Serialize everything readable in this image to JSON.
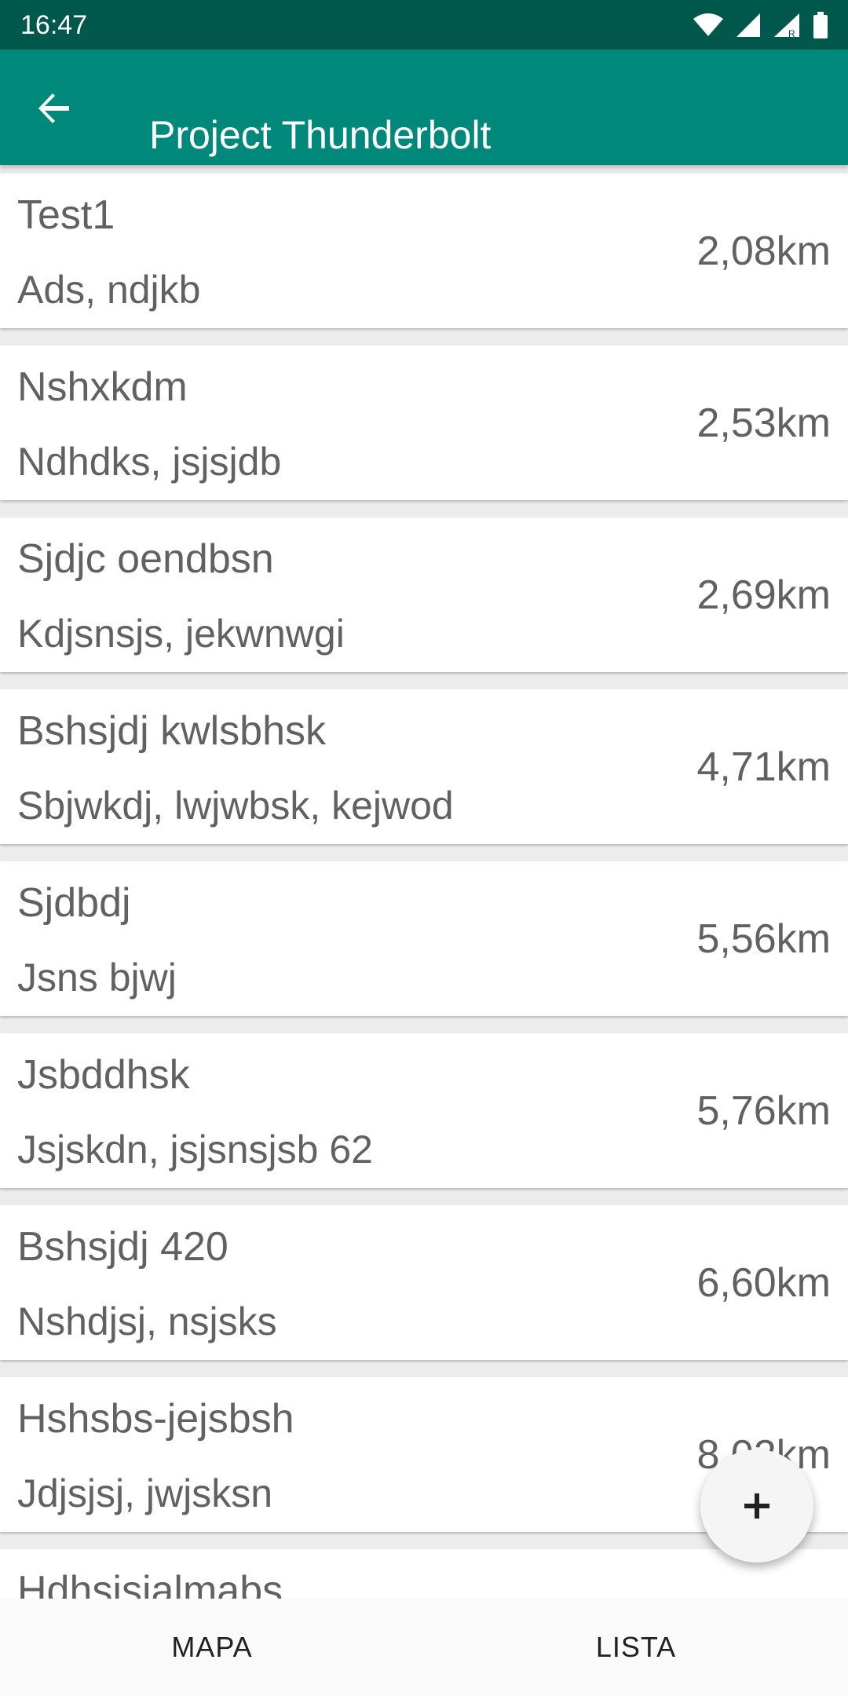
{
  "status_bar": {
    "time": "16:47",
    "icons": [
      "wifi-icon",
      "cellular-signal-icon",
      "cellular-signal-roaming-icon",
      "battery-icon"
    ],
    "background": "#00574b"
  },
  "app_bar": {
    "title": "Project Thunderbolt",
    "back_icon": "arrow-back-icon",
    "background": "#00897b"
  },
  "places": [
    {
      "name": "Test1",
      "address": "Ads, ndjkb",
      "distance": "2,08km"
    },
    {
      "name": "Nshxkdm",
      "address": "Ndhdks, jsjsjdb",
      "distance": "2,53km"
    },
    {
      "name": "Sjdjc oendbsn",
      "address": "Kdjsnsjs, jekwnwgi",
      "distance": "2,69km"
    },
    {
      "name": "Bshsjdj kwlsbhsk",
      "address": "Sbjwkdj, lwjwbsk, kejwod",
      "distance": "4,71km"
    },
    {
      "name": "Sjdbdj",
      "address": "Jsns bjwj",
      "distance": "5,56km"
    },
    {
      "name": "Jsbddhsk",
      "address": "Jsjskdn, jsjsnsjsb 62",
      "distance": "5,76km"
    },
    {
      "name": "Bshsjdj 420",
      "address": "Nshdjsj, nsjsks",
      "distance": "6,60km"
    },
    {
      "name": "Hshsbs-jejsbsh",
      "address": "Jdjsjsj, jwjsksn",
      "distance": "8,02km"
    },
    {
      "name": "Hdhsjsjalmabs",
      "address": "",
      "distance": ""
    }
  ],
  "fab": {
    "icon": "plus-icon"
  },
  "bottom_nav": {
    "tabs": [
      {
        "label": "MAPA"
      },
      {
        "label": "LISTA"
      }
    ]
  }
}
